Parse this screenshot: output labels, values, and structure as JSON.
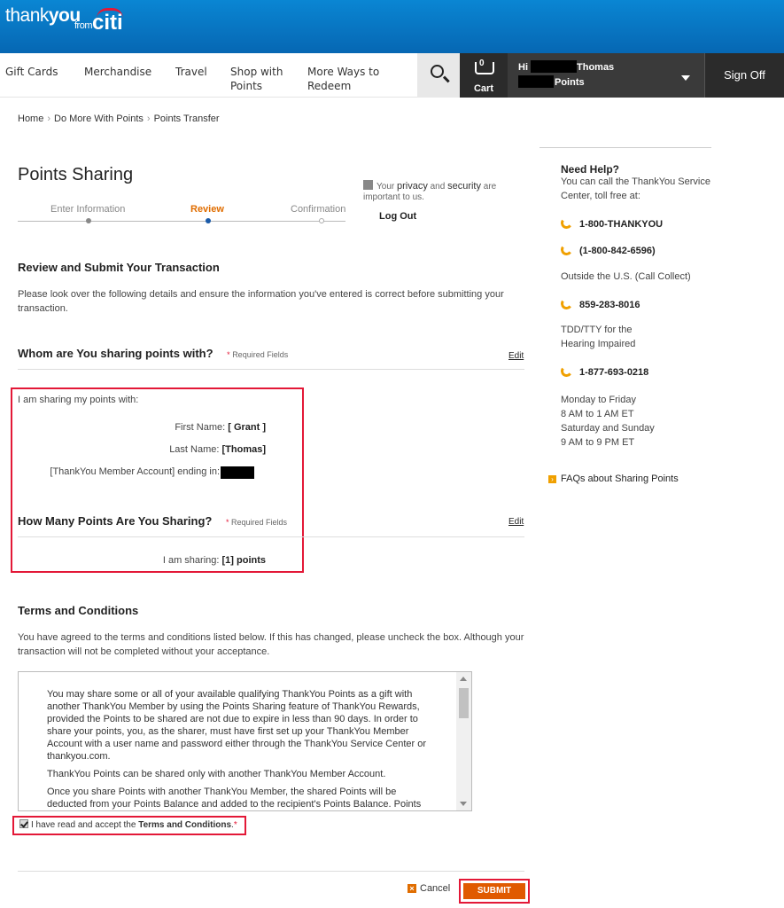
{
  "brand": {
    "thank": "thank",
    "you": "you",
    "from": "from",
    "citi": "citi"
  },
  "nav": {
    "gift_cards": "Gift Cards",
    "merchandise": "Merchandise",
    "travel": "Travel",
    "shop_line1": "Shop with",
    "shop_line2": "Points",
    "more_line1": "More Ways to",
    "more_line2": "Redeem",
    "cart_count": "0",
    "cart": "Cart",
    "hi": "Hi",
    "user_name": "Thomas",
    "points": "Points",
    "sign_off": "Sign Off"
  },
  "breadcrumb": {
    "home": "Home",
    "sep": "›",
    "do_more": "Do More With Points",
    "transfer": "Points Transfer"
  },
  "page": {
    "title": "Points Sharing"
  },
  "steps": {
    "enter": "Enter Information",
    "review": "Review",
    "confirm": "Confirmation"
  },
  "privacy": {
    "your": "Your",
    "privacy": "privacy",
    "and": "and",
    "security": "security",
    "rest": "are important to us.",
    "logout": "Log Out"
  },
  "review": {
    "heading": "Review and Submit Your Transaction",
    "text": "Please look over the following details and ensure the information you've entered is correct before submitting your transaction."
  },
  "whom": {
    "heading": "Whom are You sharing points with?",
    "required": "Required Fields",
    "required_star": "*",
    "edit": "Edit",
    "sharing_with": "I am sharing my points with:",
    "first_label": "First Name:",
    "first_value": "[ Grant ]",
    "last_label": "Last Name:",
    "last_value": "[Thomas]",
    "account_label": "[ThankYou Member Account] ending in:"
  },
  "how_many": {
    "heading": "How Many Points Are You Sharing?",
    "required": "Required Fields",
    "required_star": "*",
    "edit": "Edit",
    "sharing_label": "I am sharing:",
    "sharing_value": "[1] points"
  },
  "terms": {
    "heading": "Terms and Conditions",
    "text": "You have agreed to the terms and conditions listed below. If this has changed, please uncheck the box. Although your transaction will not be completed without your acceptance.",
    "p1": "You may share some or all of your available qualifying ThankYou Points as a gift with another ThankYou Member by using the Points Sharing feature of ThankYou Rewards, provided the Points to be shared are not due to expire in less than 90 days. In order to share your points, you, as the sharer, must have first set up your ThankYou Member Account with a user name and password either through the ThankYou Service Center or thankyou.com.",
    "p2": "ThankYou Points can be shared only with another ThankYou Member Account.",
    "p3": "Once you share Points with another ThankYou Member, the shared Points will be deducted from your Points Balance and added to the recipient's Points Balance. Points",
    "accept_pre": "I have read and accept the",
    "accept_link": "Terms and Conditions",
    "accept_dot": ".",
    "accept_star": "*"
  },
  "actions": {
    "cancel": "Cancel",
    "submit": "SUBMIT"
  },
  "help": {
    "title": "Need Help?",
    "intro": "You can call the ThankYou Service Center, toll free at:",
    "phone1": "1-800-THANKYOU",
    "phone2": "(1-800-842-6596)",
    "outside": "Outside the U.S. (Call Collect)",
    "phone3": "859-283-8016",
    "tdd": "TDD/TTY for the Hearing Impaired",
    "phone4": "1-877-693-0218",
    "hours1": "Monday to Friday",
    "hours2": "8 AM to 1 AM ET",
    "hours3": "Saturday and Sunday",
    "hours4": "9 AM to 9 PM ET",
    "faq": "FAQs about Sharing Points"
  },
  "colors": {
    "header_blue": "#0667b3",
    "accent_orange": "#e05a00",
    "highlight_red": "#e31837"
  }
}
